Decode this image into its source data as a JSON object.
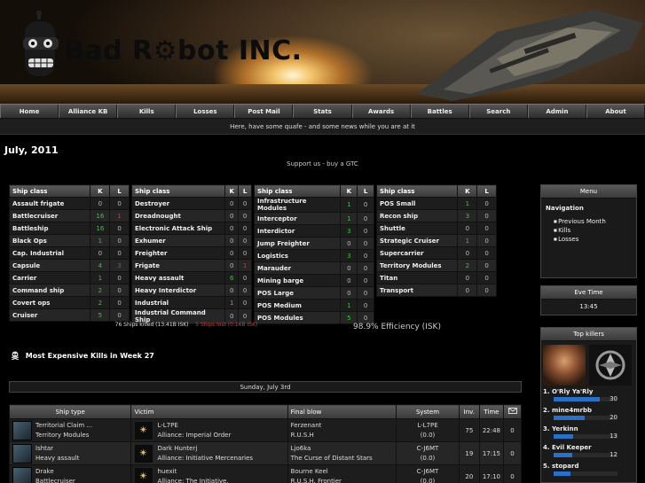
{
  "site": {
    "logo_text": "Bad R⚙bot INC."
  },
  "nav": [
    "Home",
    "Alliance KB",
    "Kills",
    "Losses",
    "Post Mail",
    "Stats",
    "Awards",
    "Battles",
    "Search",
    "Admin",
    "About"
  ],
  "subnav": "Here, have some quafe - and some news while you are at it",
  "page_title": "July, 2011",
  "support_text": "Support us - buy a GTC",
  "kill_tables": [
    {
      "header": [
        "Ship class",
        "K",
        "L"
      ],
      "rows": [
        {
          "name": "Assault frigate",
          "k": "0",
          "l": "0"
        },
        {
          "name": "Battlecruiser",
          "k": "16",
          "l": "1"
        },
        {
          "name": "Battleship",
          "k": "16",
          "l": "0"
        },
        {
          "name": "Black Ops",
          "k": "1",
          "l": "0"
        },
        {
          "name": "Cap. Industrial",
          "k": "0",
          "l": "0"
        },
        {
          "name": "Capsule",
          "k": "4",
          "l": "3"
        },
        {
          "name": "Carrier",
          "k": "1",
          "l": "0"
        },
        {
          "name": "Command ship",
          "k": "2",
          "l": "0"
        },
        {
          "name": "Covert ops",
          "k": "2",
          "l": "0"
        },
        {
          "name": "Cruiser",
          "k": "5",
          "l": "0"
        }
      ]
    },
    {
      "header": [
        "Ship class",
        "K",
        "L"
      ],
      "rows": [
        {
          "name": "Destroyer",
          "k": "0",
          "l": "0"
        },
        {
          "name": "Dreadnought",
          "k": "0",
          "l": "0"
        },
        {
          "name": "Electronic Attack Ship",
          "k": "0",
          "l": "0"
        },
        {
          "name": "Exhumer",
          "k": "0",
          "l": "0"
        },
        {
          "name": "Freighter",
          "k": "0",
          "l": "0"
        },
        {
          "name": "Frigate",
          "k": "0",
          "l": "1"
        },
        {
          "name": "Heavy assault",
          "k": "6",
          "l": "0"
        },
        {
          "name": "Heavy Interdictor",
          "k": "0",
          "l": "0"
        },
        {
          "name": "Industrial",
          "k": "1",
          "l": "0"
        },
        {
          "name": "Industrial Command Ship",
          "k": "0",
          "l": "0"
        }
      ]
    },
    {
      "header": [
        "Ship class",
        "K",
        "L"
      ],
      "rows": [
        {
          "name": "Infrastructure Modules",
          "k": "1",
          "l": "0"
        },
        {
          "name": "Interceptor",
          "k": "1",
          "l": "0"
        },
        {
          "name": "Interdictor",
          "k": "3",
          "l": "0"
        },
        {
          "name": "Jump Freighter",
          "k": "0",
          "l": "0"
        },
        {
          "name": "Logistics",
          "k": "3",
          "l": "0"
        },
        {
          "name": "Marauder",
          "k": "0",
          "l": "0"
        },
        {
          "name": "Mining barge",
          "k": "0",
          "l": "0"
        },
        {
          "name": "POS Large",
          "k": "0",
          "l": "0"
        },
        {
          "name": "POS Medium",
          "k": "1",
          "l": "0"
        },
        {
          "name": "POS Modules",
          "k": "5",
          "l": "0"
        }
      ]
    },
    {
      "header": [
        "Ship class",
        "K",
        "L"
      ],
      "rows": [
        {
          "name": "POS Small",
          "k": "1",
          "l": "0"
        },
        {
          "name": "Recon ship",
          "k": "3",
          "l": "0"
        },
        {
          "name": "Shuttle",
          "k": "0",
          "l": "0"
        },
        {
          "name": "Strategic Cruiser",
          "k": "1",
          "l": "0"
        },
        {
          "name": "Supercarrier",
          "k": "0",
          "l": "0"
        },
        {
          "name": "Territory Modules",
          "k": "2",
          "l": "0"
        },
        {
          "name": "Titan",
          "k": "0",
          "l": "0"
        },
        {
          "name": "Transport",
          "k": "0",
          "l": "0"
        }
      ]
    }
  ],
  "summary": {
    "killed": "76 Ships killed (13.41B ISK)",
    "lost": "5 Ships lost (0.16B ISK)"
  },
  "efficiency": "98.9% Efficiency (ISK)",
  "section_title": "Most Expensive Kills in Week 27",
  "day_header": "Sunday, July 3rd",
  "kill_list": {
    "headers": [
      "Ship type",
      "Victim",
      "Final blow",
      "System",
      "Inv.",
      "Time"
    ],
    "rows": [
      {
        "ship_name": "Territorial Claim ...",
        "ship_class": "Territory Modules",
        "victim": "L-L7PE",
        "victim_org": "Alliance: Imperial Order",
        "fb_name": "Ferzenant",
        "fb_corp": "R.U.S.H",
        "system": "L-L7PE",
        "security": "(0.0)",
        "inv": "75",
        "time": "22:48",
        "count": "0"
      },
      {
        "ship_name": "Ishtar",
        "ship_class": "Heavy assault",
        "victim": "Dark Hunterj",
        "victim_org": "Alliance: Initiative Mercenaries",
        "fb_name": "Ljo6ka",
        "fb_corp": "The Curse of Distant Stars",
        "system": "C-J6MT",
        "security": "(0.0)",
        "inv": "19",
        "time": "17:15",
        "count": "0"
      },
      {
        "ship_name": "Drake",
        "ship_class": "Battlecruiser",
        "victim": "huexit",
        "victim_org": "Alliance: The Initiative.",
        "fb_name": "Bourne Keel",
        "fb_corp": "R.U.S.H. Frontier",
        "system": "C-J6MT",
        "security": "(0.0)",
        "inv": "20",
        "time": "17:10",
        "count": "0"
      }
    ]
  },
  "sidebar": {
    "menu_title": "Menu",
    "menu_label": "Navigation",
    "menu_links": [
      "Previous Month",
      "Kills",
      "Losses"
    ],
    "evetime_title": "Eve Time",
    "evetime_value": "13:45",
    "topkillers_title": "Top killers",
    "killers": [
      {
        "name": "1.  O'Rly Ya'Rly",
        "count": "30",
        "fill": 1.0
      },
      {
        "name": "2.  mine4mrbb",
        "count": "20",
        "fill": 0.67
      },
      {
        "name": "3.  Yerkinn",
        "count": "13",
        "fill": 0.43
      },
      {
        "name": "4.  Evil Keeper",
        "count": "12",
        "fill": 0.4
      },
      {
        "name": "5.  stopard",
        "count": "",
        "fill": 0.37
      }
    ]
  }
}
